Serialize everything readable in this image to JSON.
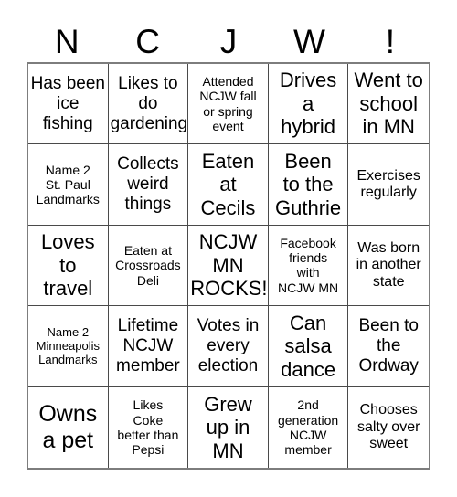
{
  "card": {
    "title_letters": [
      "N",
      "C",
      "J",
      "W",
      "!"
    ],
    "columns": 5,
    "rows": 5,
    "grid": [
      [
        {
          "text": "Has been\nice\nfishing",
          "size": "md"
        },
        {
          "text": "Likes to\ndo\ngardening",
          "size": "md"
        },
        {
          "text": "Attended\nNCJW fall\nor spring\nevent",
          "size": "xs"
        },
        {
          "text": "Drives\na\nhybrid",
          "size": "lg"
        },
        {
          "text": "Went to\nschool\nin MN",
          "size": "lg"
        }
      ],
      [
        {
          "text": "Name 2\nSt. Paul\nLandmarks",
          "size": "xs"
        },
        {
          "text": "Collects\nweird\nthings",
          "size": "md"
        },
        {
          "text": "Eaten\nat\nCecils",
          "size": "lg"
        },
        {
          "text": "Been\nto the\nGuthrie",
          "size": "lg"
        },
        {
          "text": "Exercises\nregularly",
          "size": "sm"
        }
      ],
      [
        {
          "text": "Loves\nto\ntravel",
          "size": "lg"
        },
        {
          "text": "Eaten at\nCrossroads\nDeli",
          "size": "xs"
        },
        {
          "text": "NCJW\nMN\nROCKS!",
          "size": "lg"
        },
        {
          "text": "Facebook\nfriends\nwith\nNCJW MN",
          "size": "xs"
        },
        {
          "text": "Was born\nin another\nstate",
          "size": "sm"
        }
      ],
      [
        {
          "text": "Name 2\nMinneapolis\nLandmarks",
          "size": "xxs"
        },
        {
          "text": "Lifetime\nNCJW\nmember",
          "size": "md"
        },
        {
          "text": "Votes in\nevery\nelection",
          "size": "md"
        },
        {
          "text": "Can\nsalsa\ndance",
          "size": "lg"
        },
        {
          "text": "Been to\nthe\nOrdway",
          "size": "md"
        }
      ],
      [
        {
          "text": "Owns\na pet",
          "size": "xl"
        },
        {
          "text": "Likes\nCoke\nbetter than\nPepsi",
          "size": "xs"
        },
        {
          "text": "Grew\nup in\nMN",
          "size": "lg"
        },
        {
          "text": "2nd\ngeneration\nNCJW\nmember",
          "size": "xs"
        },
        {
          "text": "Chooses\nsalty over\nsweet",
          "size": "sm"
        }
      ]
    ]
  },
  "colors": {
    "grid_border": "#7d7d7d",
    "cell_border": "#4a4a4a",
    "text": "#000000",
    "background": "#ffffff"
  }
}
